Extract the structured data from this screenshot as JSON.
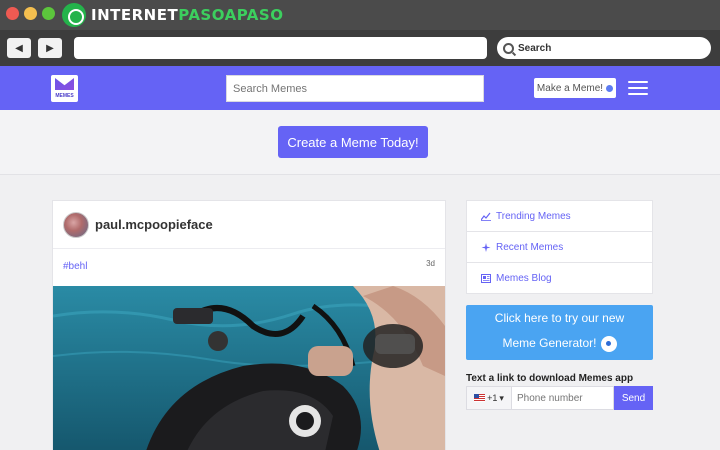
{
  "browser": {
    "brand_prefix": "INTERNET",
    "brand_highlight": "PASOAPASO",
    "search_label": "Search",
    "back_icon": "◀",
    "forward_icon": "▶"
  },
  "site": {
    "logo_text": "MEMES",
    "search_placeholder": "Search Memes",
    "make_button": "Make a Meme!",
    "create_button": "Create a Meme Today!"
  },
  "post": {
    "username": "paul.mcpoopieface",
    "tag": "#behl",
    "age": "3d"
  },
  "sidebar": {
    "items": [
      {
        "label": "Trending Memes",
        "icon": "trending-chart-icon"
      },
      {
        "label": "Recent Memes",
        "icon": "sparkle-icon"
      },
      {
        "label": "Memes Blog",
        "icon": "newspaper-icon"
      }
    ],
    "generator_line1": "Click here to try our new",
    "generator_line2": "Meme Generator!",
    "app_label": "Text a link to download Memes app",
    "country_code": "+1",
    "phone_placeholder": "Phone number",
    "send_label": "Send"
  },
  "colors": {
    "accent": "#6563f5",
    "generator_blue": "#4aa4f2"
  }
}
